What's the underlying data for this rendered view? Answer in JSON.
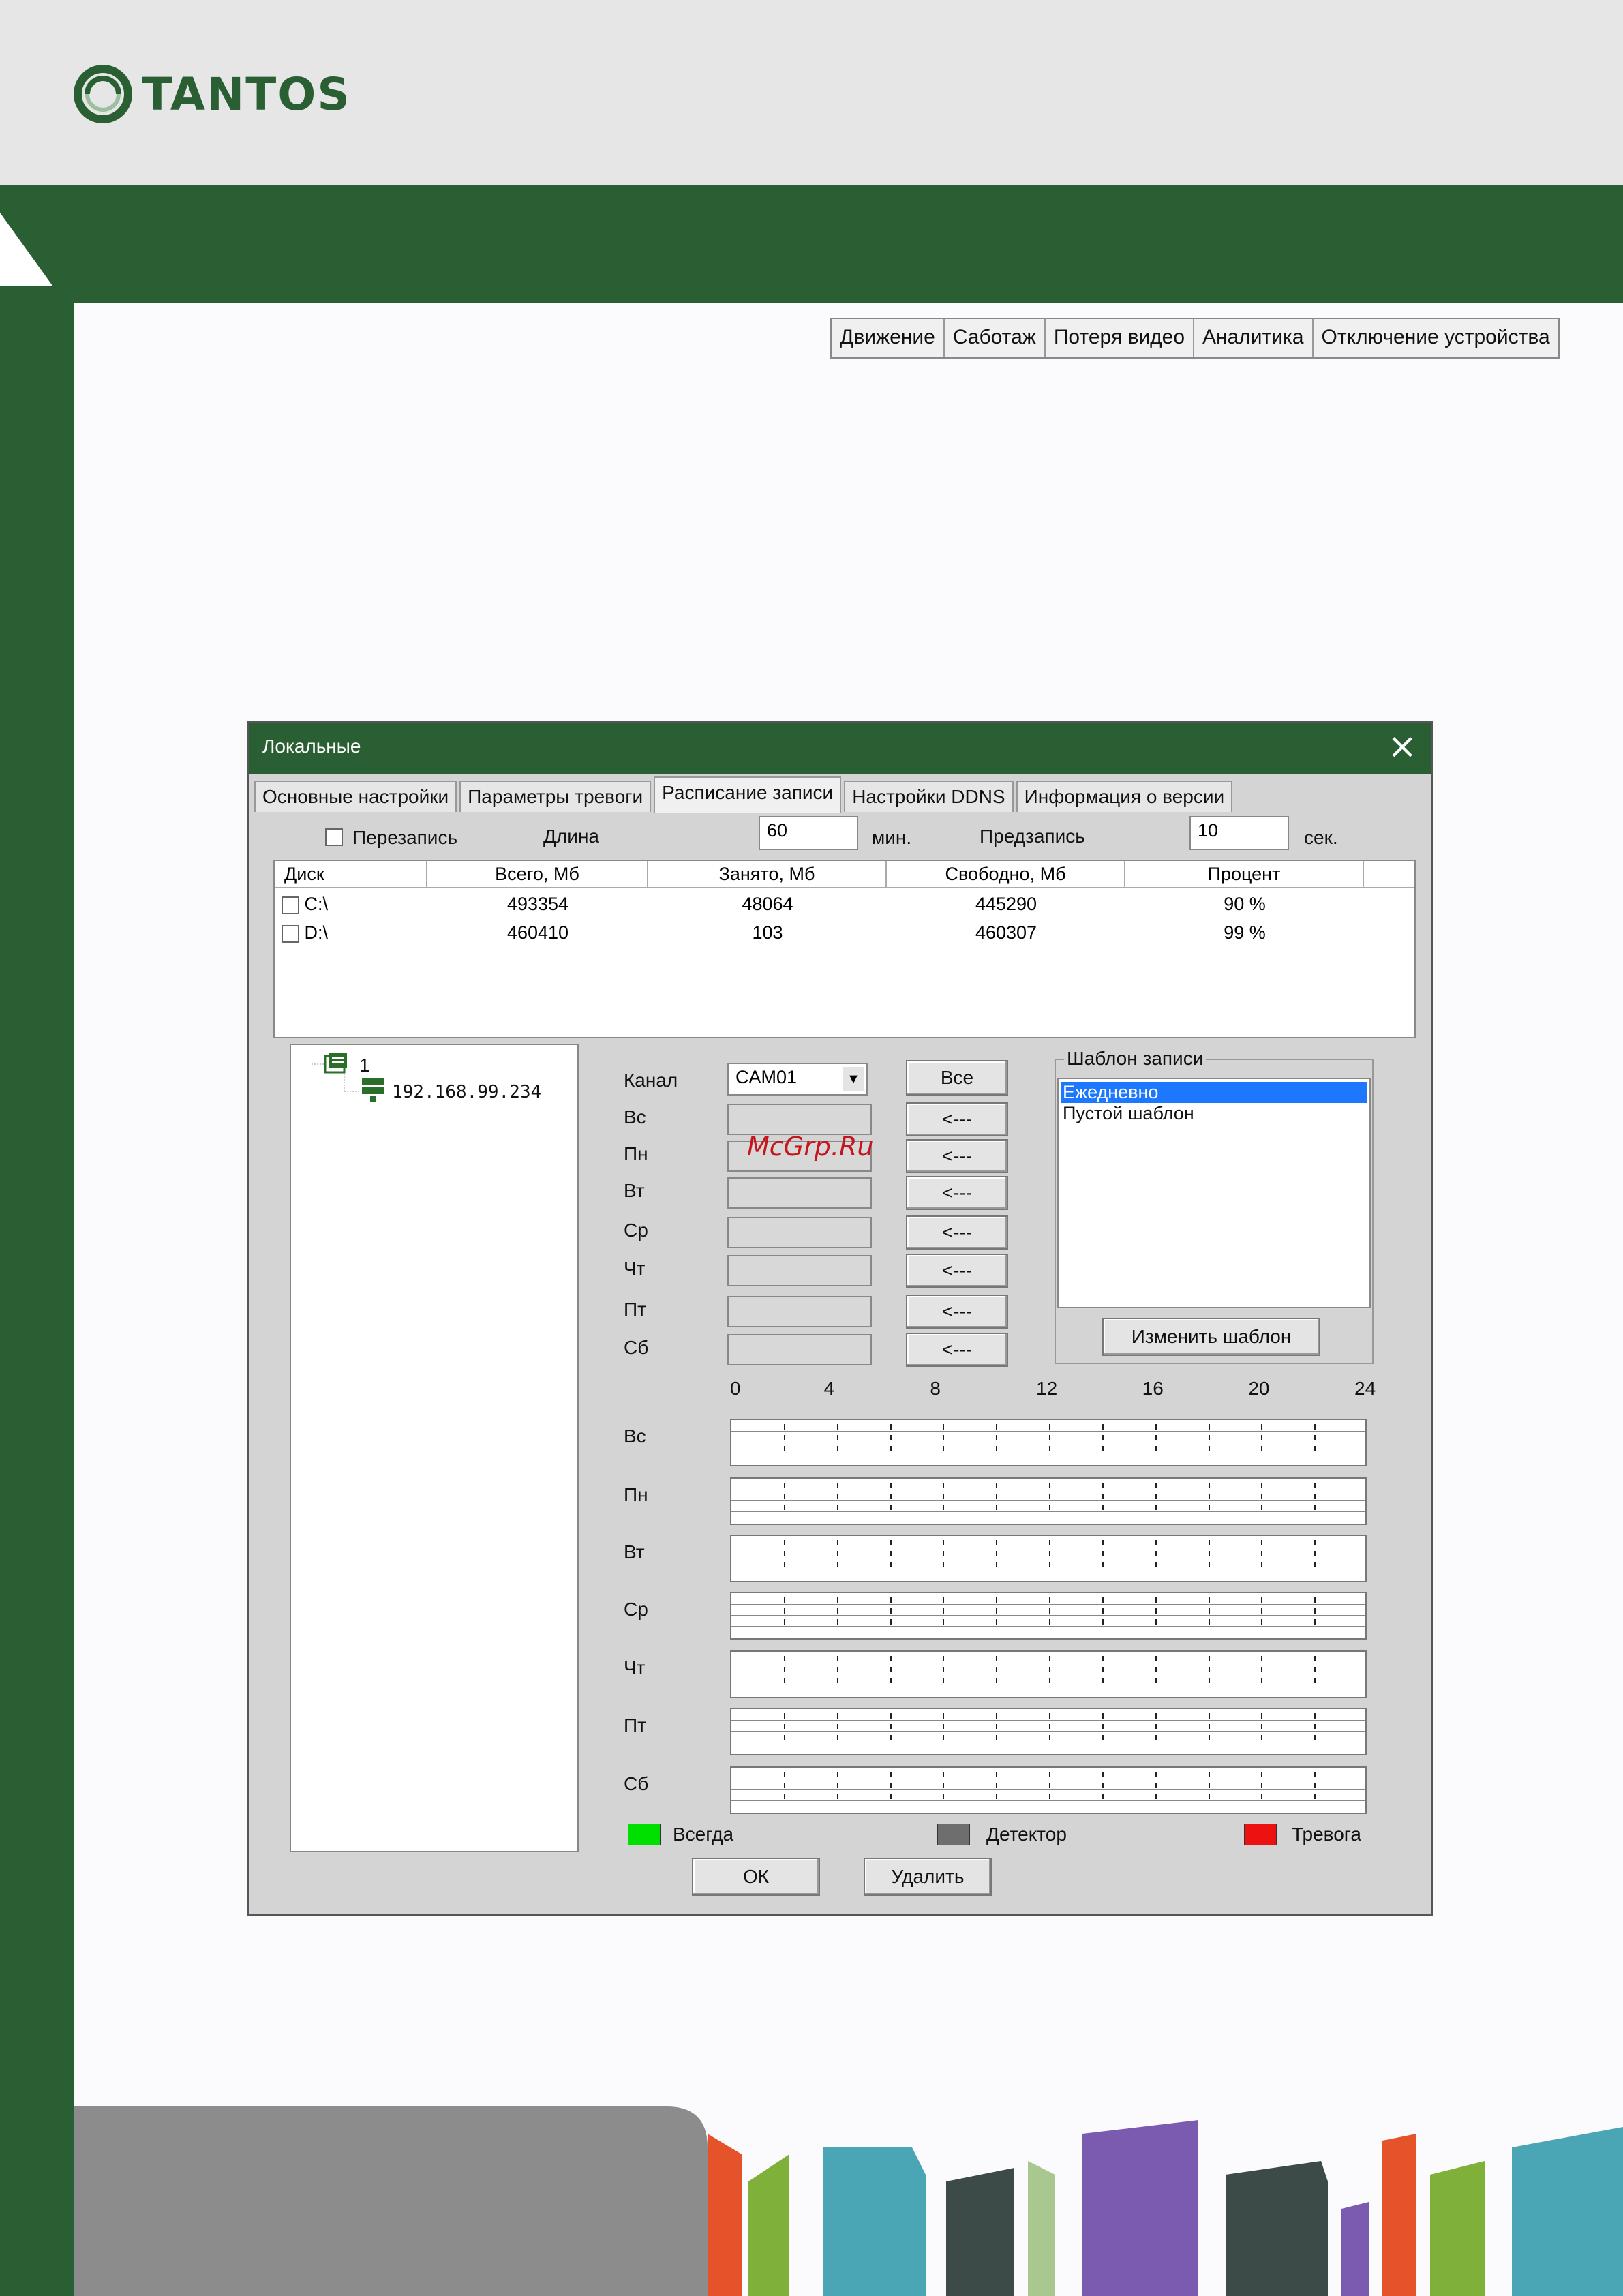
{
  "brand": {
    "logo_text": "TANTOS",
    "color": "#2a5f33"
  },
  "top_tabs": [
    "Движение",
    "Саботаж",
    "Потеря видео",
    "Аналитика",
    "Отключение устройства"
  ],
  "dialog": {
    "title": "Локальные",
    "tabs": [
      "Основные настройки",
      "Параметры тревоги",
      "Расписание записи",
      "Настройки DDNS",
      "Информация о версии"
    ],
    "active_tab": "Расписание записи",
    "overwrite_label": "Перезапись",
    "length_label": "Длина",
    "length_value": "60",
    "length_unit": "мин.",
    "prerecord_label": "Предзапись",
    "prerecord_value": "10",
    "prerecord_unit": "сек.",
    "disk_table": {
      "headers": [
        "Диск",
        "Всего, Мб",
        "Занято, Мб",
        "Свободно, Мб",
        "Процент"
      ],
      "rows": [
        {
          "disk": "C:\\",
          "total": "493354",
          "used": "48064",
          "free": "445290",
          "percent": "90 %"
        },
        {
          "disk": "D:\\",
          "total": "460410",
          "used": "103",
          "free": "460307",
          "percent": "99 %"
        }
      ]
    },
    "tree": {
      "root": "1",
      "child": "192.168.99.234"
    },
    "channel_label": "Канал",
    "channel_value": "CAM01",
    "all_button": "Все",
    "copy_button": "<---",
    "days": [
      "Вс",
      "Пн",
      "Вт",
      "Ср",
      "Чт",
      "Пт",
      "Сб"
    ],
    "template_group": "Шаблон записи",
    "templates": [
      "Ежедневно",
      "Пустой шаблон"
    ],
    "selected_template": "Ежедневно",
    "edit_template_button": "Изменить шаблон",
    "hour_ticks": [
      "0",
      "4",
      "8",
      "12",
      "16",
      "20",
      "24"
    ],
    "legend": [
      {
        "label": "Всегда",
        "color": "#00e000"
      },
      {
        "label": "Детектор",
        "color": "#6e6e6e"
      },
      {
        "label": "Тревога",
        "color": "#ee1111"
      }
    ],
    "ok_button": "ОК",
    "delete_button": "Удалить"
  },
  "watermark": "McGrp.Ru"
}
